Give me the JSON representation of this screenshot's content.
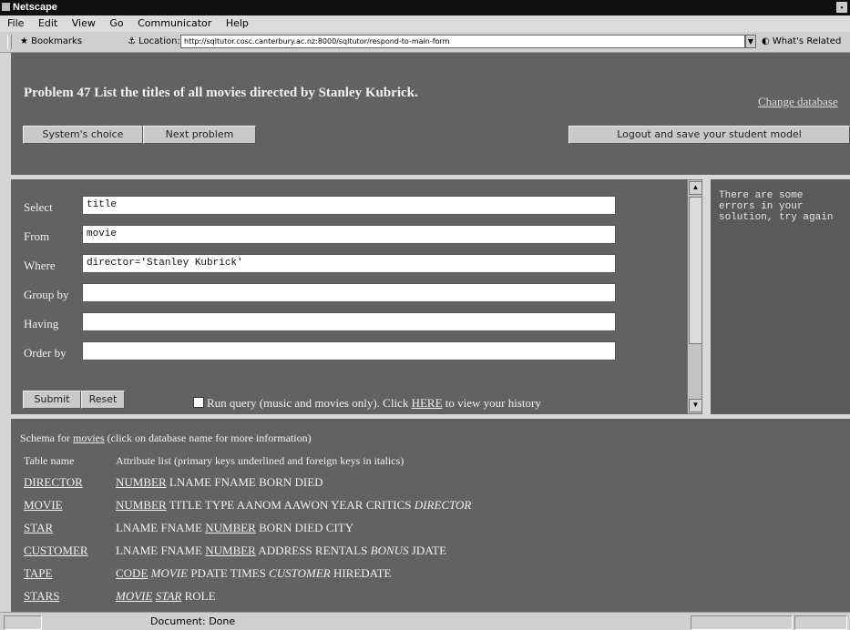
{
  "window": {
    "title": "Netscape"
  },
  "menu": [
    "File",
    "Edit",
    "View",
    "Go",
    "Communicator",
    "Help"
  ],
  "location_bar": {
    "bookmarks_label": "Bookmarks",
    "location_label": "Location:",
    "url": "http://sqltutor.cosc.canterbury.ac.nz:8000/sqltutor/respond-to-main-form",
    "related_label": "What's Related"
  },
  "problem": {
    "text": "Problem 47 List the titles of all movies directed by Stanley Kubrick.",
    "change_database": "Change database"
  },
  "buttons": {
    "systems_choice": "System's choice",
    "next_problem": "Next problem",
    "logout": "Logout and save your student model",
    "submit": "Submit",
    "reset": "Reset"
  },
  "query_form": {
    "fields": [
      {
        "label": "Select",
        "value": "title"
      },
      {
        "label": "From",
        "value": "movie"
      },
      {
        "label": "Where",
        "value": "director='Stanley Kubrick'"
      },
      {
        "label": "Group by",
        "value": ""
      },
      {
        "label": "Having",
        "value": ""
      },
      {
        "label": "Order by",
        "value": ""
      }
    ],
    "run_query_text": "Run query (music and movies only). Click ",
    "history_link": "HERE",
    "history_suffix": " to view your history"
  },
  "feedback": {
    "text": "There are some\nerrors in your\nsolution, try again"
  },
  "schema": {
    "title_prefix": "Schema for ",
    "db_name": "movies",
    "title_suffix": " (click on database name for more information)",
    "header_table": "Table name",
    "header_attrs": "Attribute list (primary keys underlined and foreign keys in italics)",
    "tables": [
      {
        "name": "DIRECTOR",
        "attrs": [
          {
            "t": "NUMBER",
            "k": "pk"
          },
          {
            "t": "LNAME"
          },
          {
            "t": "FNAME"
          },
          {
            "t": "BORN"
          },
          {
            "t": "DIED"
          }
        ]
      },
      {
        "name": "MOVIE",
        "attrs": [
          {
            "t": "NUMBER",
            "k": "pk"
          },
          {
            "t": "TITLE"
          },
          {
            "t": "TYPE"
          },
          {
            "t": "AANOM"
          },
          {
            "t": "AAWON"
          },
          {
            "t": "YEAR"
          },
          {
            "t": "CRITICS"
          },
          {
            "t": "DIRECTOR",
            "k": "fk"
          }
        ]
      },
      {
        "name": "STAR",
        "attrs": [
          {
            "t": "LNAME"
          },
          {
            "t": "FNAME"
          },
          {
            "t": "NUMBER",
            "k": "pk"
          },
          {
            "t": "BORN"
          },
          {
            "t": "DIED"
          },
          {
            "t": "CITY"
          }
        ]
      },
      {
        "name": "CUSTOMER",
        "attrs": [
          {
            "t": "LNAME"
          },
          {
            "t": "FNAME"
          },
          {
            "t": "NUMBER",
            "k": "pk"
          },
          {
            "t": "ADDRESS"
          },
          {
            "t": "RENTALS"
          },
          {
            "t": "BONUS",
            "k": "fk"
          },
          {
            "t": "JDATE"
          }
        ]
      },
      {
        "name": "TAPE",
        "attrs": [
          {
            "t": "CODE",
            "k": "pk"
          },
          {
            "t": "MOVIE",
            "k": "fk"
          },
          {
            "t": "PDATE"
          },
          {
            "t": "TIMES"
          },
          {
            "t": "CUSTOMER",
            "k": "fk"
          },
          {
            "t": "HIREDATE"
          }
        ]
      },
      {
        "name": "STARS",
        "attrs": [
          {
            "t": "MOVIE",
            "k": "pkfk"
          },
          {
            "t": "STAR",
            "k": "pkfk"
          },
          {
            "t": "ROLE"
          }
        ]
      }
    ]
  },
  "statusbar": {
    "text": "Document: Done"
  }
}
